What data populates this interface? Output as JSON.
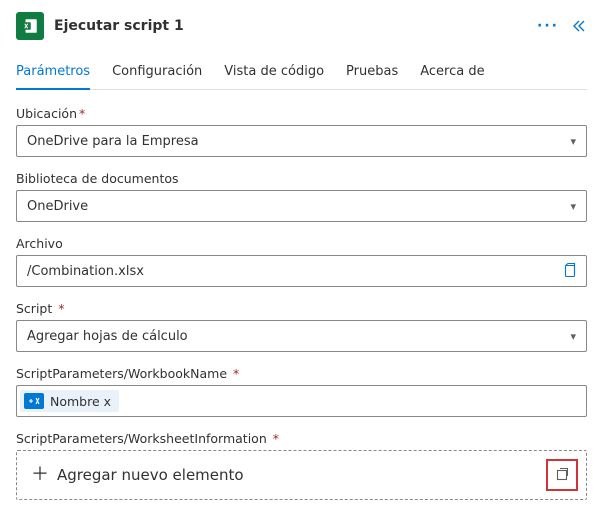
{
  "header": {
    "title": "Ejecutar script 1",
    "icon_name": "excel-icon"
  },
  "tabs": [
    {
      "label": "Parámetros",
      "active": true
    },
    {
      "label": "Configuración",
      "active": false
    },
    {
      "label": "Vista de código",
      "active": false
    },
    {
      "label": "Pruebas",
      "active": false
    },
    {
      "label": "Acerca de",
      "active": false
    }
  ],
  "fields": {
    "location": {
      "label": "Ubicación",
      "required": true,
      "value": "OneDrive para la Empresa"
    },
    "library": {
      "label": "Biblioteca de documentos",
      "required": false,
      "value": "OneDrive"
    },
    "file": {
      "label": "Archivo",
      "required": false,
      "value": "/Combination.xlsx"
    },
    "script": {
      "label": "Script",
      "required": true,
      "value": "Agregar hojas de cálculo"
    },
    "workbookName": {
      "label": "ScriptParameters/WorkbookName",
      "required": true,
      "chip_text": "Nombre x"
    },
    "worksheetInfo": {
      "label": "ScriptParameters/WorksheetInformation",
      "required": true,
      "add_label": "Agregar nuevo elemento"
    }
  },
  "colors": {
    "accent": "#0078d4",
    "excel": "#107c41",
    "danger": "#d13438"
  }
}
